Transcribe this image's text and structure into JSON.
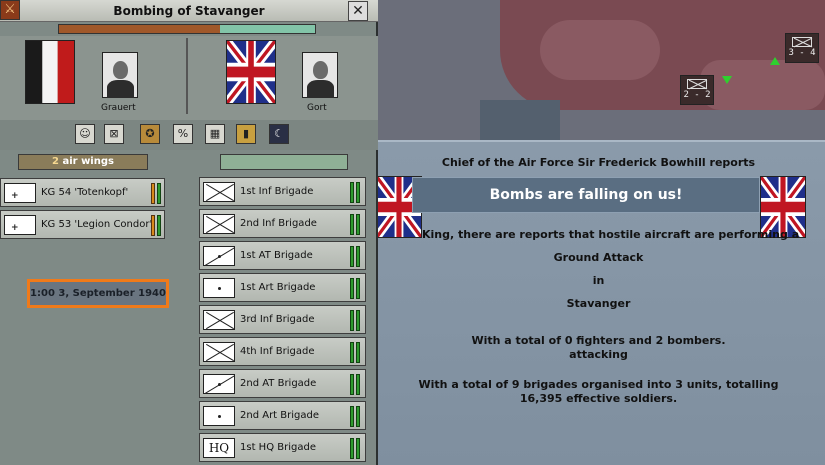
{
  "battle": {
    "title": "Bombing of Stavanger",
    "progress": 0.63,
    "date": "1:00 3, September 1940",
    "attacker": {
      "leader": "Grauert",
      "count": "2",
      "count_label": "air wings",
      "units": [
        "KG 54 'Totenkopf'",
        "KG 53 'Legion Condor'"
      ]
    },
    "defender": {
      "leader": "Gort",
      "hq_symbol": "HQ",
      "units": [
        "1st Inf Brigade",
        "2nd Inf Brigade",
        "1st AT Brigade",
        "1st Art Brigade",
        "3rd Inf Brigade",
        "4th Inf Brigade",
        "2nd AT Brigade",
        "2nd Art Brigade",
        "1st HQ Brigade"
      ]
    }
  },
  "report": {
    "header": "Chief of the Air Force Sir Frederick Bowhill reports",
    "banner": "Bombs are falling on us!",
    "lines": [
      "King, there are reports that  hostile aircraft are performing a",
      "Ground Attack",
      "in",
      "Stavanger",
      "With a total of 0 fighters and 2 bombers.",
      "attacking",
      "With a total of 9 brigades organised into 3 units, totalling",
      "16,395 effective soldiers."
    ]
  },
  "map": {
    "units": [
      {
        "strength": "2 - 2"
      },
      {
        "strength": "3 - 4"
      }
    ]
  },
  "colors": {
    "progress_attacker": "#a0582a",
    "progress_defender": "#82c4a8",
    "highlight": "#f07a1a",
    "banner": "#5a6e82"
  }
}
